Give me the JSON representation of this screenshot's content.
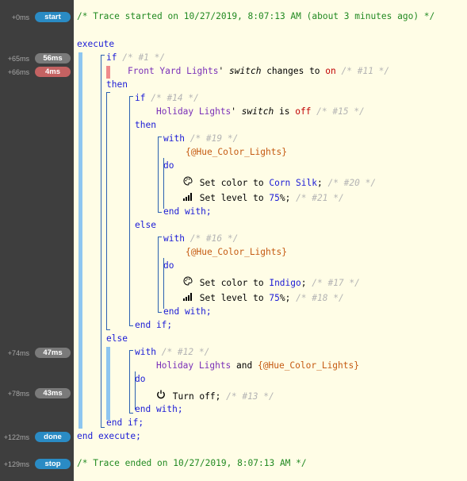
{
  "gutter": {
    "entries": [
      {
        "time": "+0ms",
        "badge": "start"
      },
      {
        "time": "+65ms",
        "badge": "56ms"
      },
      {
        "time": "+66ms",
        "badge": "4ms"
      },
      {
        "time": "+74ms",
        "badge": "47ms"
      },
      {
        "time": "+78ms",
        "badge": "43ms"
      },
      {
        "time": "+122ms",
        "badge": "done"
      },
      {
        "time": "+129ms",
        "badge": "stop"
      }
    ]
  },
  "trace": {
    "start": "/* Trace started on 10/27/2019, 8:07:13 AM (about 3 minutes ago) */",
    "end": "/* Trace ended on 10/27/2019, 8:07:13 AM */"
  },
  "code": {
    "execute": "execute",
    "if": "if",
    "c1": "/* #1 */",
    "device_front": "Front Yard Lights",
    "apos": "'",
    "switch": "switch",
    "changes_to": "changes to",
    "on": "on",
    "c11": "/* #11 */",
    "then": "then",
    "c14": "/* #14 */",
    "device_holiday": "Holiday Lights",
    "is": "is",
    "off": "off",
    "c15": "/* #15 */",
    "with": "with",
    "c19": "/* #19 */",
    "hue_var": "{@Hue_Color_Lights}",
    "do": "do",
    "set_color_to": "Set color to",
    "corn_silk": "Corn Silk",
    "semi": ";",
    "c20": "/* #20 */",
    "set_level_to": "Set level to",
    "level": "75",
    "pct": "%",
    "c21": "/* #21 */",
    "end_with": "end with;",
    "else": "else",
    "c16": "/* #16 */",
    "indigo": "Indigo",
    "c17": "/* #17 */",
    "c18": "/* #18 */",
    "end_if": "end if;",
    "c12": "/* #12 */",
    "and": "and",
    "turn_off": "Turn off;",
    "c13": "/* #13 */",
    "end_execute": "end execute;"
  },
  "icons": {
    "palette": "palette-icon",
    "signal": "signal-bars-icon",
    "power": "power-icon"
  },
  "colors": {
    "keyword": "#1b1bd6",
    "comment": "#b4b4b4",
    "device": "#7a2fb8",
    "variable": "#c55a11",
    "value": "#c00000",
    "trace": "#228a22",
    "badge_blue": "#2a8bc4",
    "badge_gray": "#7a7a7a",
    "badge_red": "#c46262",
    "background": "#fffde6",
    "gutter": "#3e3e3e",
    "activity_bar": "#8ec6f0",
    "activity_bar_hot": "#f08b8b"
  }
}
